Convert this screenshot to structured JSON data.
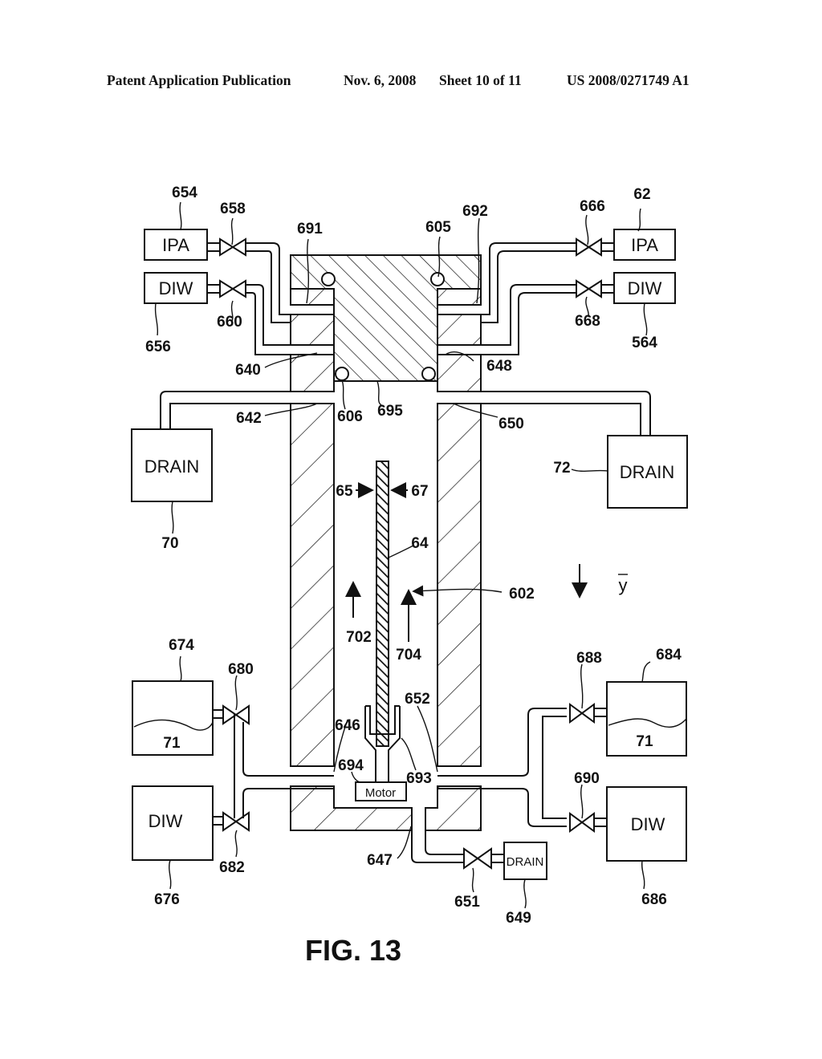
{
  "header": {
    "publication": "Patent Application Publication",
    "date": "Nov. 6, 2008",
    "sheet": "Sheet 10 of 11",
    "patent_number": "US 2008/0271749 A1"
  },
  "figure": {
    "caption": "FIG. 13",
    "units": {
      "ipa_left": {
        "text": "IPA",
        "ref": "654"
      },
      "diw_left_top": {
        "text": "DIW",
        "ref": "656"
      },
      "ipa_right": {
        "text": "IPA",
        "ref": "62"
      },
      "diw_right_top": {
        "text": "DIW",
        "ref": "564"
      },
      "drain_left": {
        "text": "DRAIN",
        "ref": "70"
      },
      "drain_right": {
        "text": "DRAIN",
        "ref": "72"
      },
      "tank_left": {
        "text": "71",
        "ref": "674"
      },
      "diw_left_bottom": {
        "text": "DIW",
        "ref": "676"
      },
      "tank_right": {
        "text": "71",
        "ref": "684"
      },
      "diw_right_bottom": {
        "text": "DIW",
        "ref": "686"
      },
      "drain_bottom": {
        "text": "DRAIN",
        "ref": "649"
      },
      "motor": {
        "text": "Motor"
      }
    },
    "valves": {
      "v658": "658",
      "v660": "660",
      "v666": "666",
      "v668": "668",
      "v680": "680",
      "v682": "682",
      "v688": "688",
      "v690": "690",
      "v651": "651"
    },
    "refs": {
      "r691": "691",
      "r605": "605",
      "r692": "692",
      "r640": "640",
      "r648": "648",
      "r606": "606",
      "r695": "695",
      "r642": "642",
      "r650": "650",
      "r65": "65",
      "r67": "67",
      "r64": "64",
      "r602": "602",
      "r702": "702",
      "r704": "704",
      "r646": "646",
      "r652": "652",
      "r694": "694",
      "r693": "693",
      "r647": "647"
    },
    "direction": {
      "label": "y"
    }
  }
}
